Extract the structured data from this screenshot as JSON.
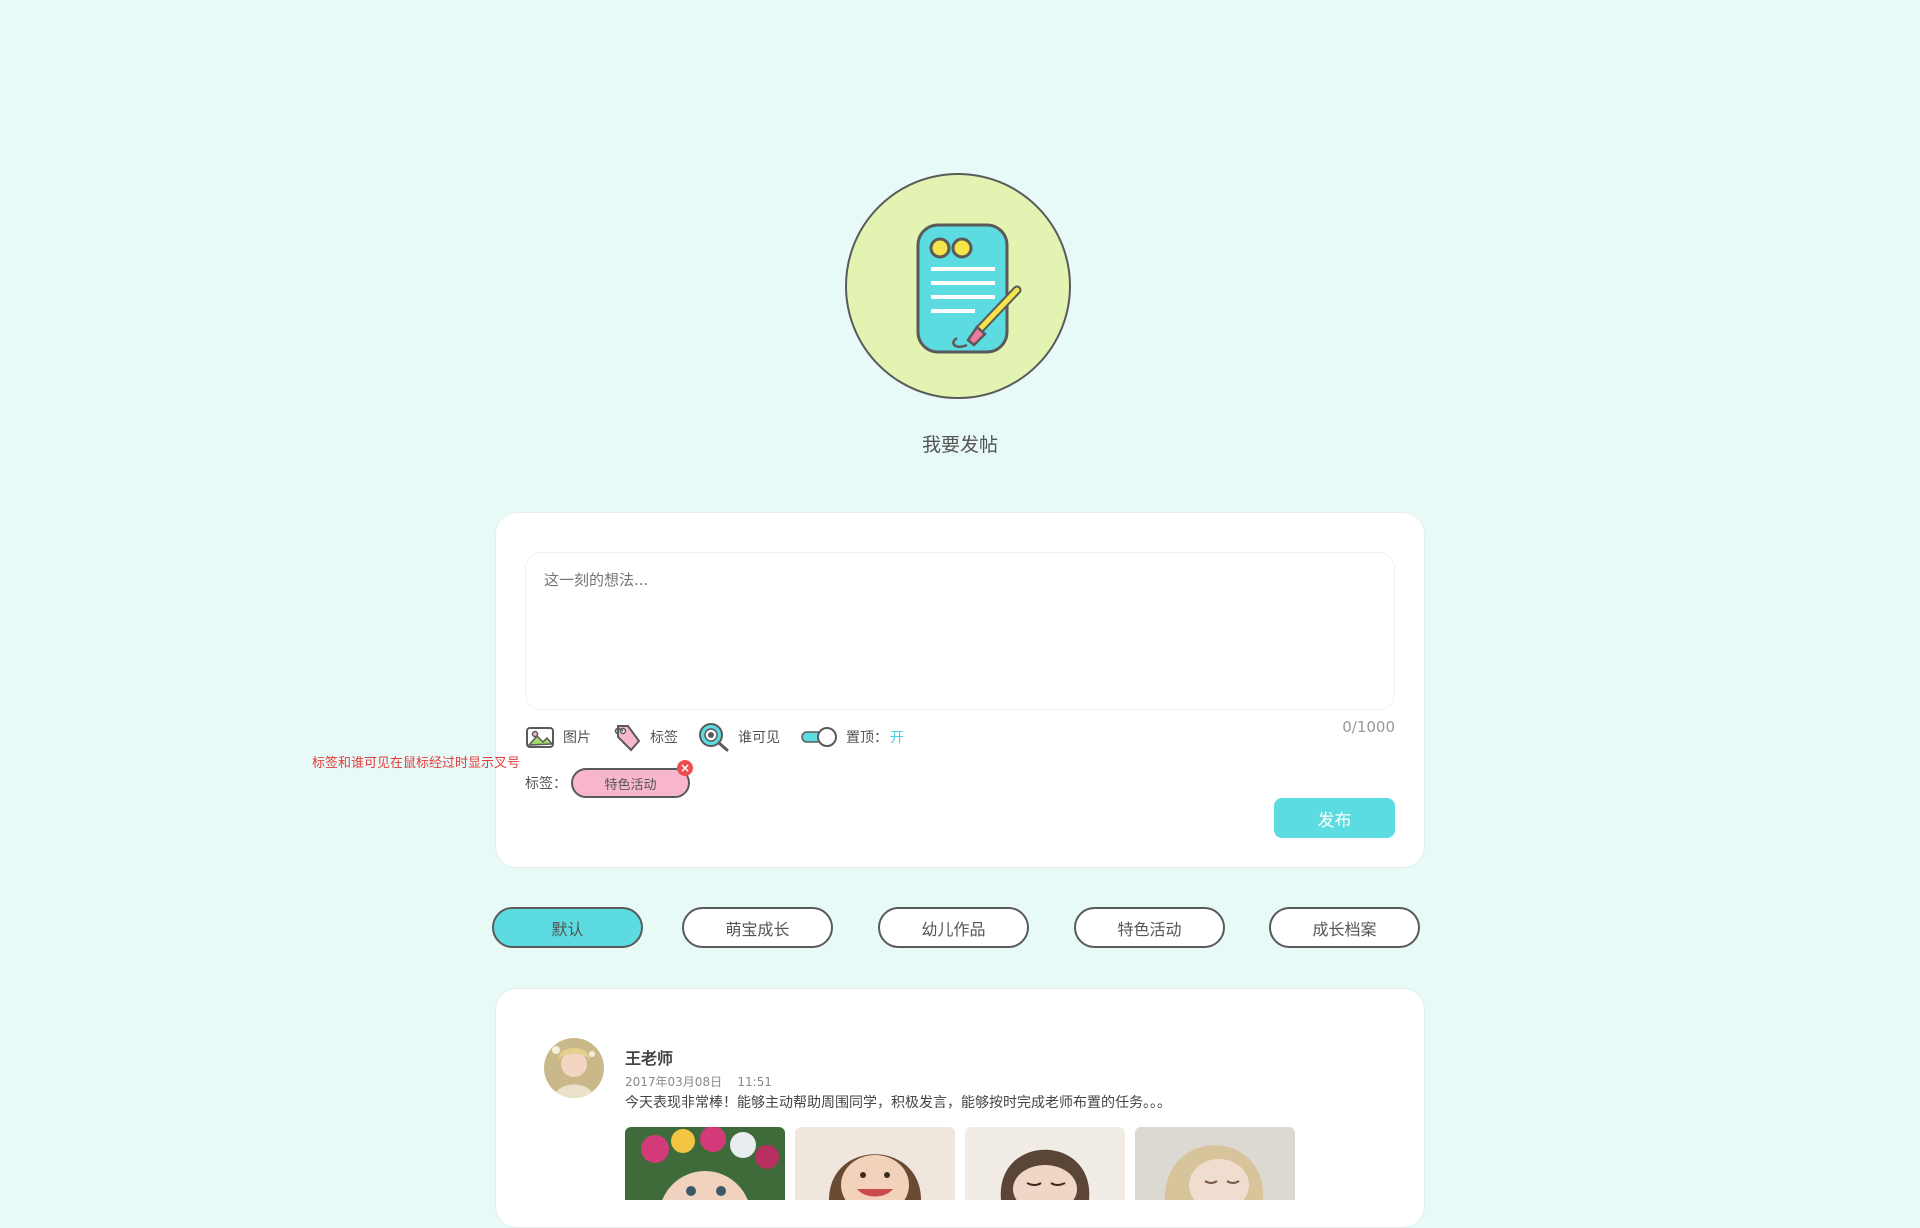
{
  "hero": {
    "title": "我要发帖"
  },
  "compose": {
    "placeholder": "这一刻的想法...",
    "counter": "0/1000",
    "tools": {
      "image": "图片",
      "tag": "标签",
      "visibility": "谁可见",
      "pin_label": "置顶：",
      "pin_state": "开"
    },
    "note": "标签和谁可见在鼠标经过时显示叉号",
    "tag_row_label": "标签：",
    "selected_tag": "特色活动",
    "publish": "发布"
  },
  "filters": [
    {
      "label": "默认",
      "active": true
    },
    {
      "label": "萌宝成长",
      "active": false
    },
    {
      "label": "幼儿作品",
      "active": false
    },
    {
      "label": "特色活动",
      "active": false
    },
    {
      "label": "成长档案",
      "active": false
    }
  ],
  "post": {
    "author": "王老师",
    "date": "2017年03月08日    11:51",
    "text": "今天表现非常棒！能够主动帮助周围同学，积极发言，能够按时完成老师布置的任务。。。"
  },
  "colors": {
    "background": "#e8faf7",
    "accent": "#5cdbe1",
    "hero_circle": "#e2f3b2",
    "tag_pink": "#f7b6cd",
    "warning_red": "#e23b3b"
  },
  "icons": {
    "hero": "notepad-pen-icon",
    "image": "picture-icon",
    "tag": "tag-icon",
    "visibility": "eye-magnifier-icon",
    "pin": "toggle-switch-icon",
    "close": "close-icon"
  }
}
